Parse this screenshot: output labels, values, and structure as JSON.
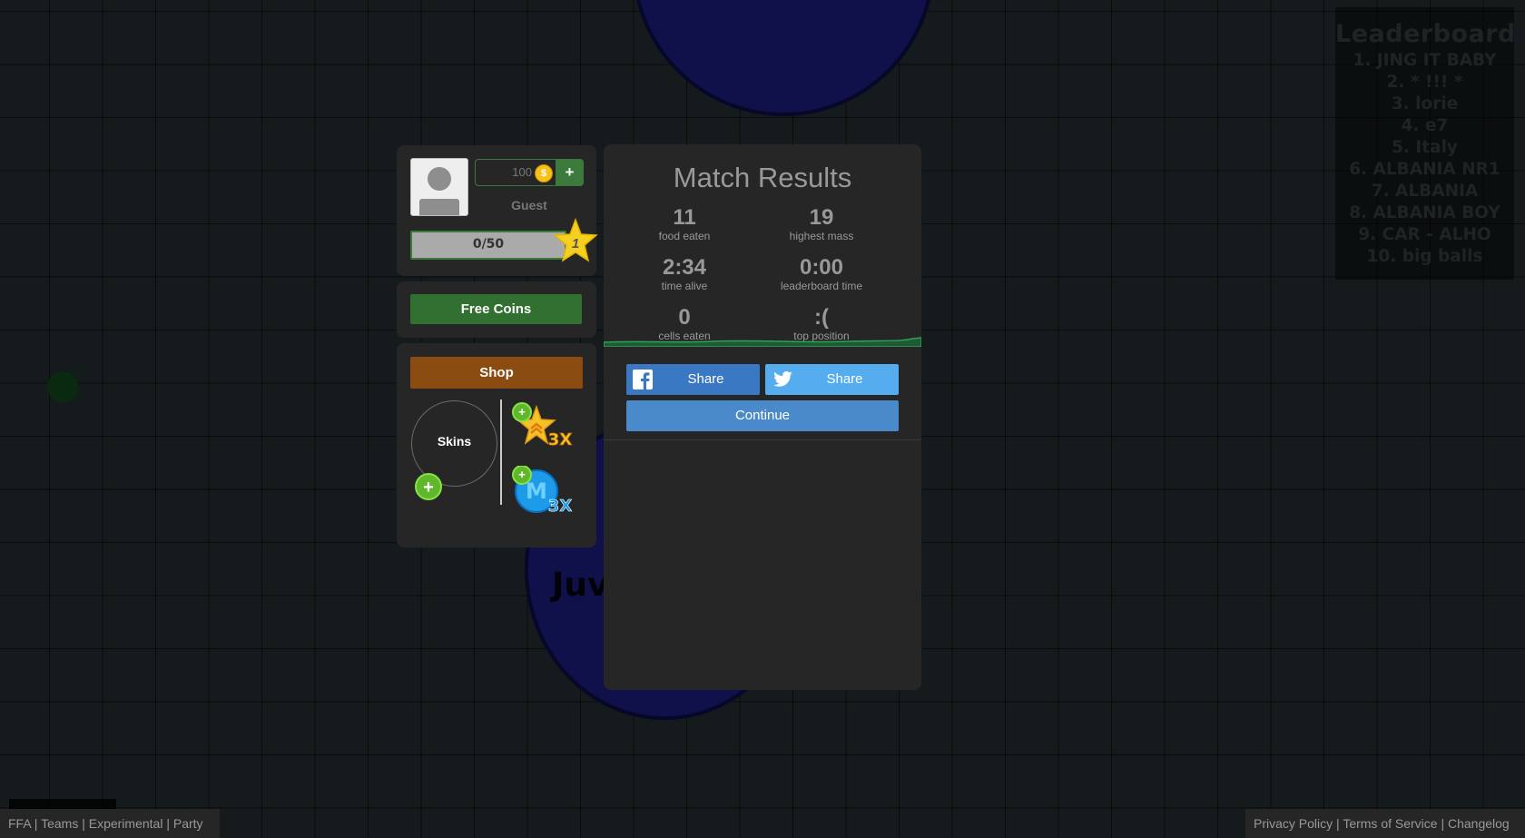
{
  "game": {
    "cell_name": "Juv"
  },
  "leaderboard": {
    "title": "Leaderboard",
    "entries": [
      "1. JING IT BABY",
      "2. * !!! *",
      "3. lorie",
      "4. e7",
      "5. Italy",
      "6. ALBANIA NR1",
      "7. ALBANIA",
      "8. ALBANIA BOY",
      "9. CAR -  ALHO",
      "10. big balls"
    ]
  },
  "profile": {
    "coins": "100",
    "coin_symbol": "$",
    "add_label": "+",
    "name": "Guest",
    "xp": "0/50",
    "level": "1"
  },
  "free_coins": {
    "label": "Free Coins"
  },
  "shop": {
    "label": "Shop",
    "skins_label": "Skins",
    "skins_add": "+",
    "boosts": [
      {
        "icon": "xp-boost-icon",
        "multiplier": "3X"
      },
      {
        "icon": "mass-boost-icon",
        "multiplier": "3X"
      }
    ]
  },
  "results": {
    "title": "Match Results",
    "stats": {
      "food_eaten": {
        "value": "11",
        "label": "food eaten"
      },
      "highest_mass": {
        "value": "19",
        "label": "highest mass"
      },
      "time_alive": {
        "value": "2:34",
        "label": "time alive"
      },
      "leaderboard_time": {
        "value": "0:00",
        "label": "leaderboard time"
      },
      "cells_eaten": {
        "value": "0",
        "label": "cells eaten"
      },
      "top_position": {
        "value": ":(",
        "label": "top position"
      }
    },
    "facebook_share": "Share",
    "twitter_share": "Share",
    "continue": "Continue"
  },
  "footer": {
    "left_links": [
      "FFA",
      "Teams",
      "Experimental",
      "Party"
    ],
    "right_links": [
      "Privacy Policy",
      "Terms of Service",
      "Changelog"
    ],
    "separator": " | "
  },
  "colors": {
    "background": "#151a1c",
    "panel": "#262626",
    "green": "#327031",
    "shop_brown": "#8b4c11",
    "facebook": "#3a78c4",
    "twitter": "#55acee",
    "continue": "#4a8acb"
  }
}
